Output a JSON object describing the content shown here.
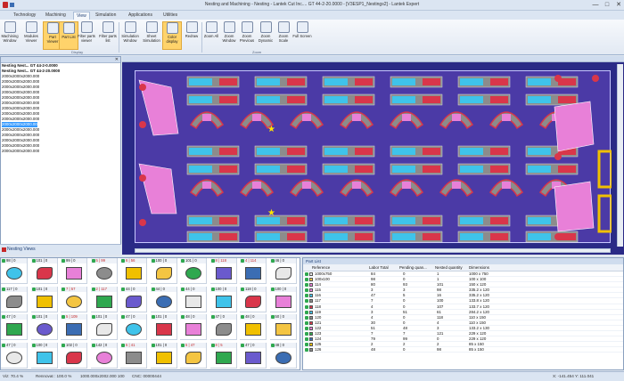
{
  "app": {
    "title": "Nesting and Machining - Nesting - Lantek Cut Inc.... GT 44-2-20.0000 - [V3ESP1_Nestings2] - Lantek Expert",
    "minimize": "—",
    "maximize": "□",
    "close": "✕"
  },
  "menu": {
    "tabs": [
      "Technology",
      "Machining",
      "View",
      "Simulation",
      "Applications",
      "Utilities"
    ],
    "active": "View"
  },
  "ribbon": {
    "buttons": [
      {
        "label": "Machining Window",
        "icon": "window-icon"
      },
      {
        "label": "Modules Viewer",
        "icon": "modules-icon"
      },
      {
        "label": "Part Viewer",
        "icon": "part-viewer-icon",
        "selected": true
      },
      {
        "label": "Part List",
        "icon": "part-list-icon",
        "selected": true
      },
      {
        "label": "Filter parts viewer",
        "icon": "filter-icon"
      },
      {
        "label": "Filter parts list",
        "icon": "filter-list-icon"
      },
      {
        "label": "Simulation Window",
        "icon": "simulation-icon"
      },
      {
        "label": "Sheet Simulation",
        "icon": "sheet-sim-icon"
      },
      {
        "label": "Color display",
        "icon": "color-display-icon",
        "selected": true
      },
      {
        "label": "Redraw",
        "icon": "redraw-icon"
      },
      {
        "label": "Zoom All",
        "icon": "zoom-all-icon"
      },
      {
        "label": "Zoom Window",
        "icon": "zoom-window-icon"
      },
      {
        "label": "Zoom Previous",
        "icon": "zoom-previous-icon"
      },
      {
        "label": "Zoom Dynamic",
        "icon": "zoom-dynamic-icon"
      },
      {
        "label": "Zoom Scale",
        "icon": "zoom-scale-icon"
      },
      {
        "label": "Full Screen",
        "icon": "full-screen-icon"
      }
    ],
    "groups": {
      "display": "Display",
      "zoom": "Zoom"
    }
  },
  "tree": {
    "items": [
      {
        "text": "Nesting Nest... GT 44-2-0.0000",
        "bold": true
      },
      {
        "text": "Nesting Nest... GT 44-2-20.0000",
        "bold": true
      },
      {
        "text": "2000x2000x2000.000"
      },
      {
        "text": "2000x2000x2000.000"
      },
      {
        "text": "2000x2000x2000.000"
      },
      {
        "text": "2000x2000x2000.000"
      },
      {
        "text": "2000x2000x2000.000"
      },
      {
        "text": "2000x2000x2000.000"
      },
      {
        "text": "2000x2000x2000.000"
      },
      {
        "text": "2000x2000x2000.000"
      },
      {
        "text": "2000x2000x2000.000"
      },
      {
        "text": "2000x2000x2000.000",
        "selected": true
      },
      {
        "text": "2000x2000x2000.000"
      },
      {
        "text": "2000x2000x2000.000"
      },
      {
        "text": "2000x2000x2000.000"
      },
      {
        "text": "2000x2000x2000.000"
      },
      {
        "text": "2000x2000x2000.000"
      }
    ],
    "tab_label": "Nesting Views"
  },
  "viewer": {
    "colors": {
      "background": "#2a2a86",
      "sheet": "#4b3aa6",
      "part_pink": "#e880d8",
      "part_red": "#d9364a",
      "part_cyan": "#3fc3ea",
      "part_gray": "#8c8c8c",
      "part_yellow": "#f0c000",
      "star": "#ffe600"
    }
  },
  "parts_grid": {
    "rows": [
      [
        {
          "h": "98 | 0"
        },
        {
          "h": "101 | 0"
        },
        {
          "h": "99 | 0"
        },
        {
          "h": "5 | 99",
          "red": true
        },
        {
          "h": "6 | 56",
          "red": true
        },
        {
          "h": "100 | 0"
        },
        {
          "h": "101 | 0"
        },
        {
          "h": "8 | 118",
          "red": true
        },
        {
          "h": "4 | 114",
          "red": true
        },
        {
          "h": "46 | 0"
        }
      ],
      [
        {
          "h": "117 | 0"
        },
        {
          "h": "101 | 0"
        },
        {
          "h": "7 | 57",
          "red": true
        },
        {
          "h": "2 | 117",
          "red": true
        },
        {
          "h": "44 | 0"
        },
        {
          "h": "44 | 0"
        },
        {
          "h": "44 | 0"
        },
        {
          "h": "100 | 0"
        },
        {
          "h": "118 | 0"
        },
        {
          "h": "100 | 0"
        }
      ],
      [
        {
          "h": "47 | 0"
        },
        {
          "h": "101 | 0"
        },
        {
          "h": "5 | 109",
          "red": true
        },
        {
          "h": "101 | 0"
        },
        {
          "h": "47 | 0"
        },
        {
          "h": "101 | 0"
        },
        {
          "h": "48 | 0"
        },
        {
          "h": "47 | 0"
        },
        {
          "h": "48 | 0"
        },
        {
          "h": "50 | 0"
        }
      ],
      [
        {
          "h": "47 | 0"
        },
        {
          "h": "100 | 0"
        },
        {
          "h": "102 | 0"
        },
        {
          "h": "142 | 0"
        },
        {
          "h": "5 | 41",
          "red": true
        },
        {
          "h": "101 | 0"
        },
        {
          "h": "5 | 47",
          "red": true
        },
        {
          "h": "8 | 5",
          "red": true
        },
        {
          "h": "47 | 0"
        },
        {
          "h": "48 | 0"
        }
      ]
    ]
  },
  "part_list": {
    "title": "Part List",
    "columns": [
      "Reference",
      "Labor Total",
      "Pending quan...",
      "Nested quantity",
      "Dimensions"
    ],
    "rows": [
      {
        "ref": "1000x750",
        "labor": "84",
        "pending": "0",
        "nested": "1",
        "dims": "1000 x 750",
        "color": "#e8e8e8"
      },
      {
        "ref": "100x100",
        "labor": "98",
        "pending": "0",
        "nested": "1",
        "dims": "100 x 100",
        "color": "#f4c542"
      },
      {
        "ref": "114",
        "labor": "80",
        "pending": "93",
        "nested": "101",
        "dims": "150 x 120",
        "color": "#e880d8"
      },
      {
        "ref": "115",
        "labor": "3",
        "pending": "3",
        "nested": "98",
        "dims": "335.2 x 120",
        "color": "#e880d8"
      },
      {
        "ref": "116",
        "labor": "47",
        "pending": "5",
        "nested": "16",
        "dims": "335.2 x 120",
        "color": "#3fc3ea"
      },
      {
        "ref": "117",
        "labor": "7",
        "pending": "0",
        "nested": "100",
        "dims": "133.8 x 120",
        "color": "#8c8c8c"
      },
      {
        "ref": "118",
        "labor": "4",
        "pending": "0",
        "nested": "107",
        "dims": "133.7 x 120",
        "color": "#d9364a"
      },
      {
        "ref": "119",
        "labor": "3",
        "pending": "51",
        "nested": "61",
        "dims": "284.2 x 120",
        "color": "#3fc3ea"
      },
      {
        "ref": "120",
        "labor": "4",
        "pending": "0",
        "nested": "118",
        "dims": "110 x 150",
        "color": "#8c8c8c"
      },
      {
        "ref": "121",
        "labor": "30",
        "pending": "0",
        "nested": "4",
        "dims": "110 x 150",
        "color": "#d9364a"
      },
      {
        "ref": "122",
        "labor": "51",
        "pending": "48",
        "nested": "3",
        "dims": "133.2 x 130",
        "color": "#e880d8"
      },
      {
        "ref": "123",
        "labor": "7",
        "pending": "7",
        "nested": "121",
        "dims": "229 x 120",
        "color": "#2fa84f"
      },
      {
        "ref": "124",
        "labor": "79",
        "pending": "99",
        "nested": "0",
        "dims": "229 x 120",
        "color": "#3b6db3"
      },
      {
        "ref": "125",
        "labor": "2",
        "pending": "2",
        "nested": "2",
        "dims": "85 x 150",
        "color": "#f0c000"
      },
      {
        "ref": "126",
        "labor": "48",
        "pending": "0",
        "nested": "98",
        "dims": "85 x 150",
        "color": "#8c8c8c"
      }
    ]
  },
  "status": {
    "left": "Viz: 70.4 %",
    "mid": "Rennovat : 100.0 %",
    "coords": "1000.000x2002.000 100",
    "cnc": "CNC: 00000444",
    "right": "X: -141.454    Y: 111.041"
  }
}
